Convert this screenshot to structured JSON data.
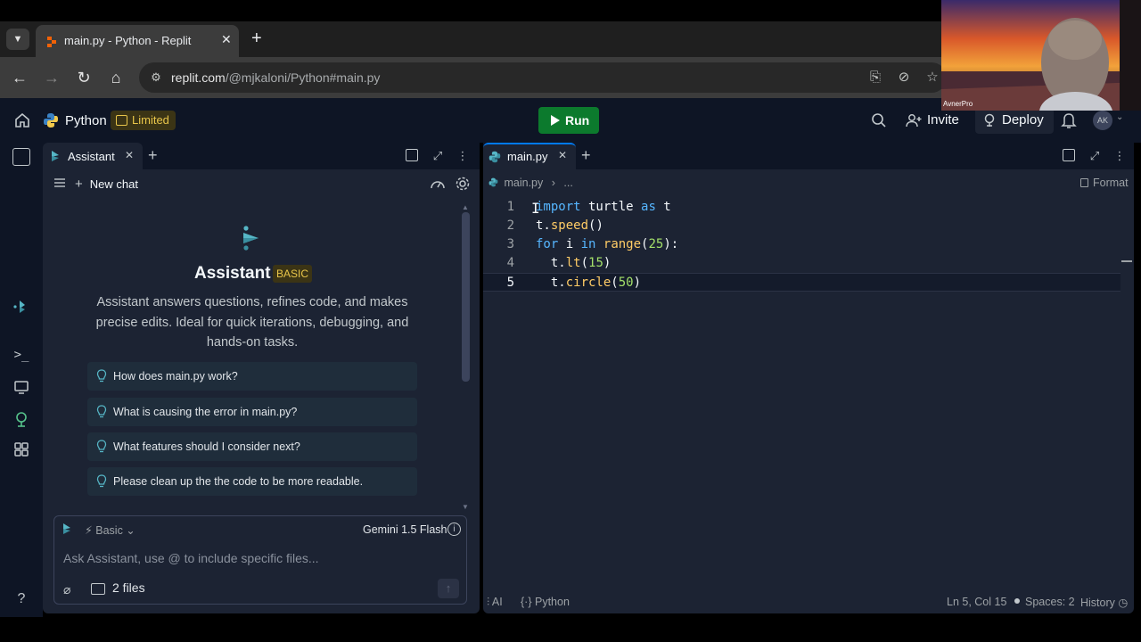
{
  "browser": {
    "tab_title": "main.py - Python - Replit",
    "url_host": "replit.com",
    "url_path": "/@mjkaloni/Python#main.py"
  },
  "header": {
    "project_name": "Python",
    "limited_label": "Limited",
    "run_label": "Run",
    "invite_label": "Invite",
    "deploy_label": "Deploy",
    "avatar_initials": "AK"
  },
  "assistant": {
    "tab_label": "Assistant",
    "new_chat_label": "New chat",
    "title": "Assistant",
    "badge": "BASIC",
    "description": "Assistant answers questions, refines code, and makes precise edits. Ideal for quick iterations, debugging, and hands-on tasks.",
    "suggestions": [
      "How does main.py work?",
      "What is causing the error in main.py?",
      "What features should I consider next?",
      "Please clean up the the code to be more readable."
    ],
    "composer": {
      "mode": "Basic",
      "model": "Gemini 1.5 Flash",
      "placeholder": "Ask Assistant, use @ to include specific files...",
      "files_label": "2 files"
    }
  },
  "editor": {
    "tab_label": "main.py",
    "breadcrumb_file": "main.py",
    "breadcrumb_more": "...",
    "format_label": "Format",
    "line_numbers": [
      "1",
      "2",
      "3",
      "4",
      "5"
    ],
    "code_lines": [
      "import turtle as t",
      "t.speed()",
      "for i in range(25):",
      "  t.lt(15)",
      "  t.circle(50)"
    ],
    "status": {
      "ai": "AI",
      "language": "Python",
      "position": "Ln 5, Col 15",
      "spaces": "Spaces: 2",
      "history": "History"
    }
  },
  "webcam": {
    "label": "AvnerPro"
  },
  "colors": {
    "replit_bg": "#0e1525",
    "panel_bg": "#1c2333",
    "run_green": "#0c7a2d",
    "accent_blue": "#0079f2",
    "badge_yellow": "#e8c54a"
  }
}
